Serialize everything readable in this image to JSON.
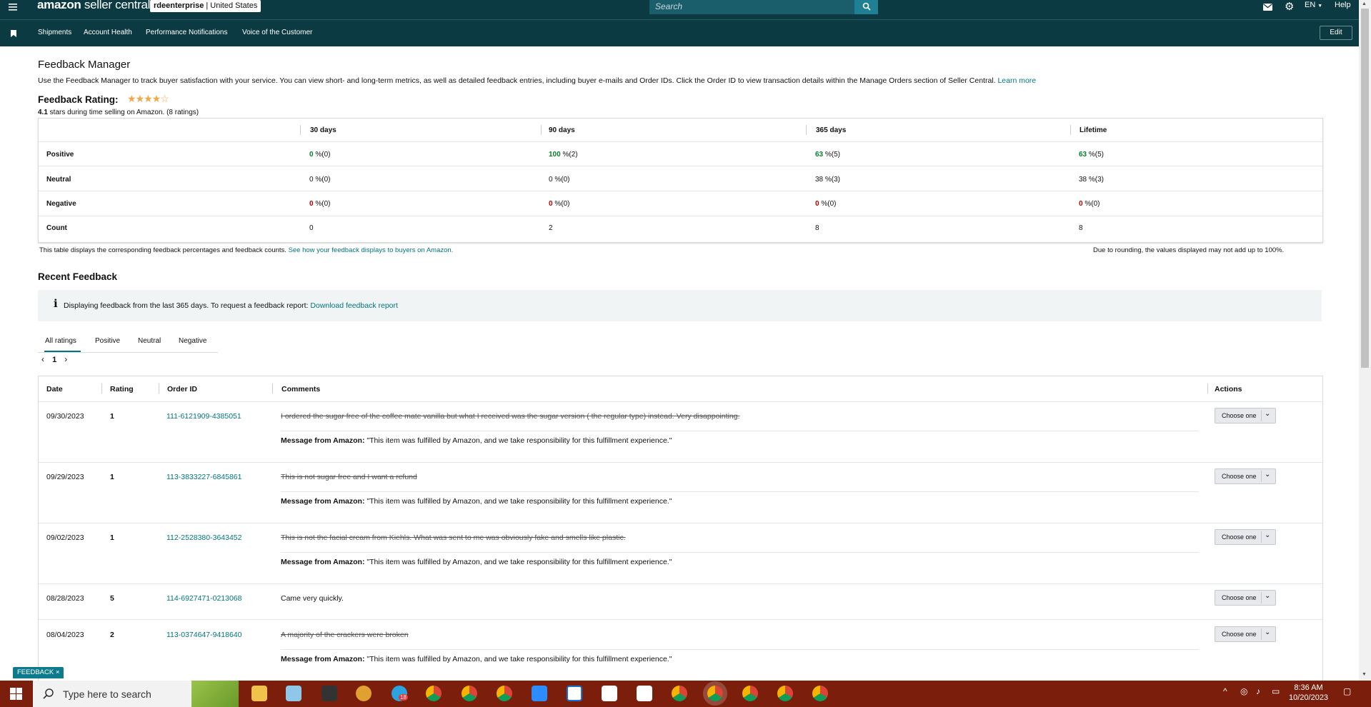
{
  "topbar": {
    "brand": "amazon",
    "brand_sub": " seller central",
    "store_name": "rdeenterprise",
    "store_sep": " | ",
    "store_region": "United States",
    "search_placeholder": "Search",
    "language": "EN",
    "help": "Help"
  },
  "subnav": {
    "items": [
      "Shipments",
      "Account Health",
      "Performance Notifications",
      "Voice of the Customer"
    ],
    "edit": "Edit"
  },
  "page": {
    "title": "Feedback Manager",
    "description": "Use the Feedback Manager to track buyer satisfaction with your service. You can view short- and long-term metrics, as well as detailed feedback entries, including buyer e-mails and Order IDs. Click the Order ID to view transaction details within the Manage Orders section of Seller Central. ",
    "learn_more": "Learn more",
    "rating_label": "Feedback Rating:",
    "rating_stars": 4.1,
    "rating_value": "4.1",
    "rating_text": " stars during time selling on Amazon. (8 ratings)"
  },
  "metrics": {
    "headers": [
      "30 days",
      "90 days",
      "365 days",
      "Lifetime"
    ],
    "rows": [
      {
        "label": "Positive",
        "cells": [
          [
            "0",
            " %(0)"
          ],
          [
            "100",
            " %(2)"
          ],
          [
            "63",
            " %(5)"
          ],
          [
            "63",
            " %(5)"
          ]
        ]
      },
      {
        "label": "Neutral",
        "cells": [
          [
            "0",
            " %(0)"
          ],
          [
            "0",
            " %(0)"
          ],
          [
            "38",
            " %(3)"
          ],
          [
            "38",
            " %(3)"
          ]
        ]
      },
      {
        "label": "Negative",
        "cells": [
          [
            "0",
            " %(0)"
          ],
          [
            "0",
            " %(0)"
          ],
          [
            "0",
            " %(0)"
          ],
          [
            "0",
            " %(0)"
          ]
        ]
      },
      {
        "label": "Count",
        "cells": [
          [
            "0",
            ""
          ],
          [
            "2",
            ""
          ],
          [
            "8",
            ""
          ],
          [
            "8",
            ""
          ]
        ]
      }
    ],
    "note": "This table displays the corresponding feedback percentages and feedback counts. ",
    "note_link": "See how your feedback displays to buyers on Amazon.",
    "rounding_note": "Due to rounding, the values displayed may not add up to 100%."
  },
  "recent": {
    "title": "Recent Feedback",
    "info_icon": "i",
    "info_text": "Displaying feedback from the last 365 days. To request a feedback report: ",
    "info_link": "Download feedback report",
    "tabs": [
      "All ratings",
      "Positive",
      "Neutral",
      "Negative"
    ],
    "page": "1",
    "columns": [
      "Date",
      "Rating",
      "Order ID",
      "Comments",
      "Actions"
    ],
    "message_label": "Message from Amazon:",
    "message_text": " \"This item was fulfilled by Amazon, and we take responsibility for this fulfillment experience.\"",
    "choose": "Choose one",
    "rows": [
      {
        "date": "09/30/2023",
        "rating": "1",
        "order": "111-6121909-4385051",
        "comment": "I ordered the sugar free of the coffee mate vanilla but what I received was the sugar version ( the regular type) instead. Very disappointing.",
        "struck": true
      },
      {
        "date": "09/29/2023",
        "rating": "1",
        "order": "113-3833227-6845861",
        "comment": "This is not sugar free and I want a refund",
        "struck": true
      },
      {
        "date": "09/02/2023",
        "rating": "1",
        "order": "112-2528380-3643452",
        "comment": "This is not the facial cream from Kiehls. What was sent to me was obviously fake and smells like plastic.",
        "struck": true
      },
      {
        "date": "08/28/2023",
        "rating": "5",
        "order": "114-6927471-0213068",
        "comment": "Came very quickly.",
        "struck": false
      },
      {
        "date": "08/04/2023",
        "rating": "2",
        "order": "113-0374647-9418640",
        "comment": "A majority of the crackers were broken",
        "struck": true
      }
    ]
  },
  "feedback_tab": "FEEDBACK ×",
  "taskbar": {
    "search_placeholder": "Type here to search",
    "time": "8:36 AM",
    "date": "10/20/2023",
    "badge": "18"
  },
  "colors": {
    "header_bg": "#0b3a43",
    "link": "#00767e",
    "positive": "#067d2d",
    "negative": "#b00000",
    "taskbar": "#7b1f0c"
  }
}
